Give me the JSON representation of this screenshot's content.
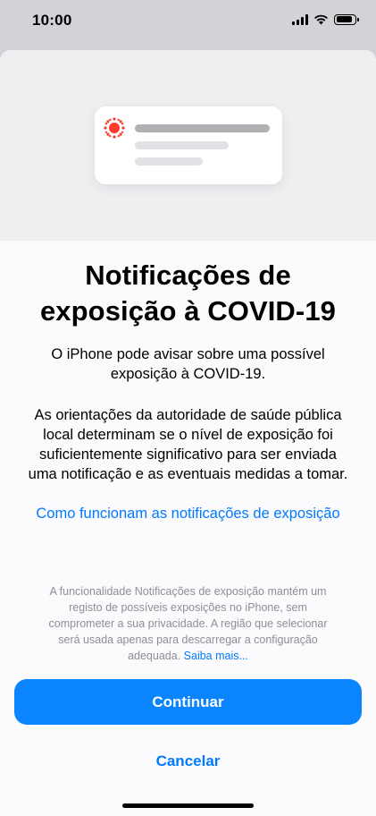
{
  "status_bar": {
    "time": "10:00",
    "icons": [
      "cellular-signal-icon",
      "wifi-icon",
      "battery-icon"
    ]
  },
  "hero": {
    "notification_icon": "exposure-virus-icon",
    "icon_color": "#ff3b30"
  },
  "content": {
    "title_line1": "Notificações de",
    "title_line2": "exposição à COVID-19",
    "intro_line1": "O iPhone pode avisar sobre uma possível",
    "intro_line2": "exposição à COVID-19.",
    "guidance_line1": "As orientações da autoridade de saúde pública",
    "guidance_line2": "local determinam se o nível de exposição foi",
    "guidance_line3": "suficientemente significativo para ser enviada",
    "guidance_line4": "uma notificação e as eventuais medidas a tomar.",
    "how_it_works_link": "Como funcionam as notificações de exposição"
  },
  "privacy": {
    "line1": "A funcionalidade Notificações de exposição mantém um",
    "line2": "registo de possíveis exposições no iPhone, sem",
    "line3": "comprometer a sua privacidade. A região que selecionar",
    "line4": "será usada apenas para descarregar a configuração",
    "line5": "adequada.",
    "learn_more": "Saiba mais..."
  },
  "actions": {
    "continue_label": "Continuar",
    "cancel_label": "Cancelar"
  },
  "colors": {
    "accent": "#007aff",
    "button": "#0a84ff",
    "alert_red": "#ff3b30"
  }
}
